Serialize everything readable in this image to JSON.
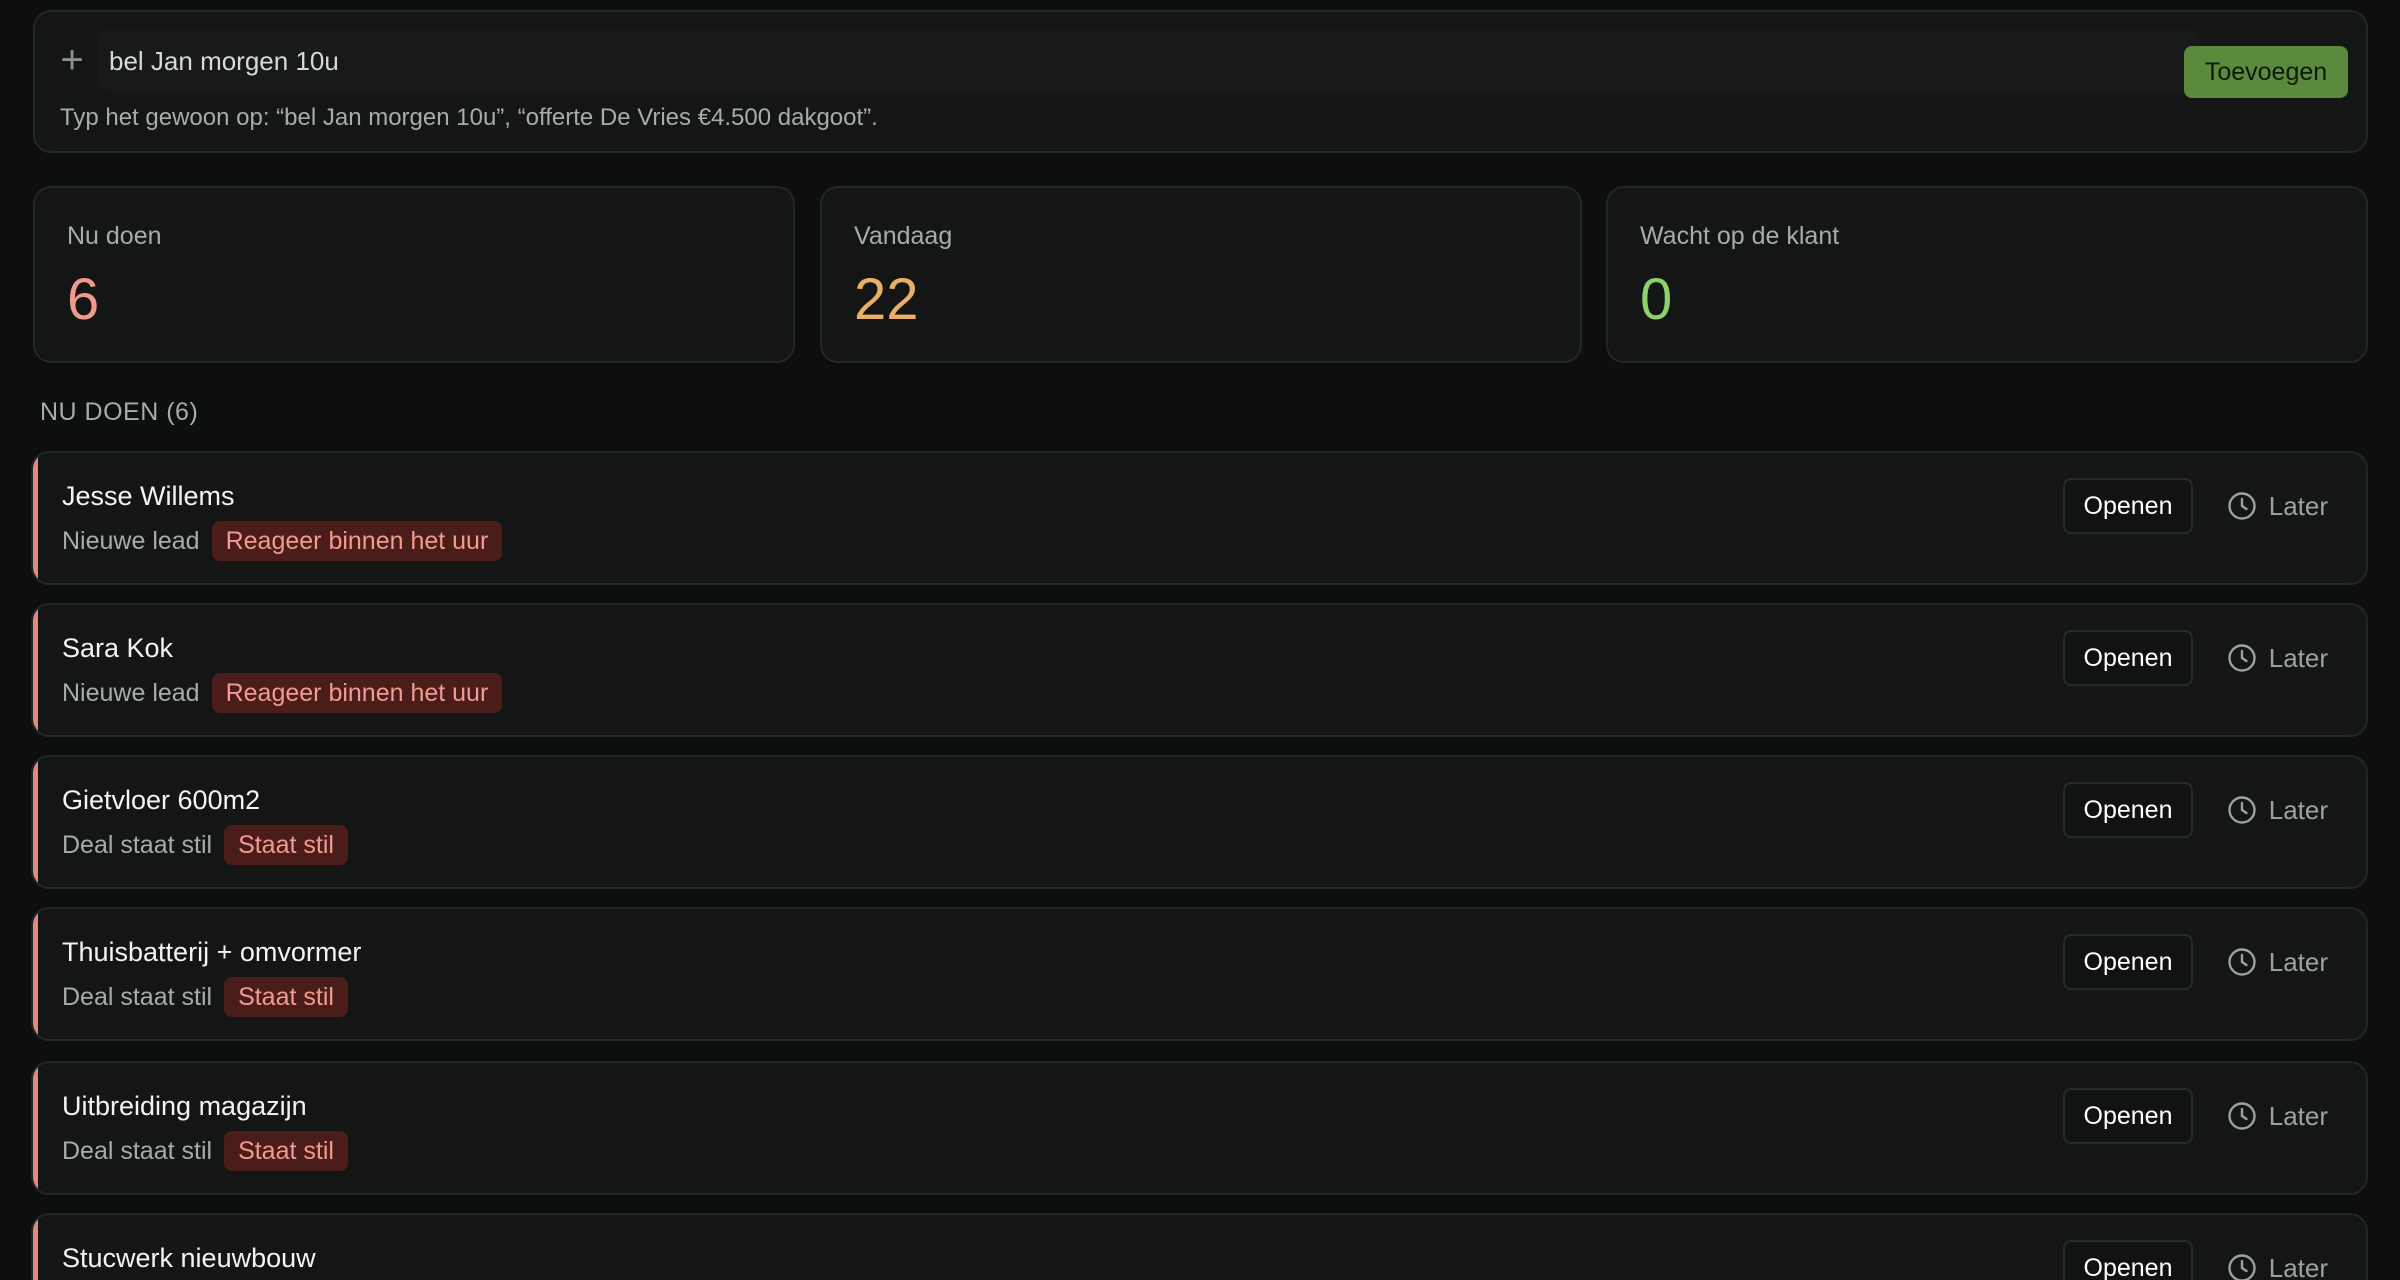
{
  "quick_add": {
    "value": "bel Jan morgen 10u",
    "button_label": "Toevoegen",
    "hint": "Typ het gewoon op: “bel Jan morgen 10u”, “offerte De Vries €4.500 dakgoot”."
  },
  "stats": [
    {
      "label": "Nu doen",
      "value": "6",
      "color": "#ef9a8a"
    },
    {
      "label": "Vandaag",
      "value": "22",
      "color": "#e9ae6a"
    },
    {
      "label": "Wacht op de klant",
      "value": "0",
      "color": "#8fd06a"
    }
  ],
  "section": {
    "title": "NU DOEN (6)"
  },
  "tasks": [
    {
      "title": "Jesse Willems",
      "subtitle": "Nieuwe lead",
      "badge": "Reageer binnen het uur",
      "open_label": "Openen",
      "later_label": "Later"
    },
    {
      "title": "Sara Kok",
      "subtitle": "Nieuwe lead",
      "badge": "Reageer binnen het uur",
      "open_label": "Openen",
      "later_label": "Later"
    },
    {
      "title": "Gietvloer 600m2",
      "subtitle": "Deal staat stil",
      "badge": "Staat stil",
      "open_label": "Openen",
      "later_label": "Later"
    },
    {
      "title": "Thuisbatterij + omvormer",
      "subtitle": "Deal staat stil",
      "badge": "Staat stil",
      "open_label": "Openen",
      "later_label": "Later"
    },
    {
      "title": "Uitbreiding magazijn",
      "subtitle": "Deal staat stil",
      "badge": "Staat stil",
      "open_label": "Openen",
      "later_label": "Later"
    },
    {
      "title": "Stucwerk nieuwbouw",
      "subtitle": "",
      "badge": "",
      "open_label": "Openen",
      "later_label": "Later"
    }
  ],
  "icons": {
    "add": "plus-icon",
    "later": "clock-icon"
  },
  "colors": {
    "accent_green": "#5a8a3c",
    "task_accent": "#e38a80",
    "badge_bg": "#4a1d1b",
    "badge_text": "#f29a90"
  }
}
